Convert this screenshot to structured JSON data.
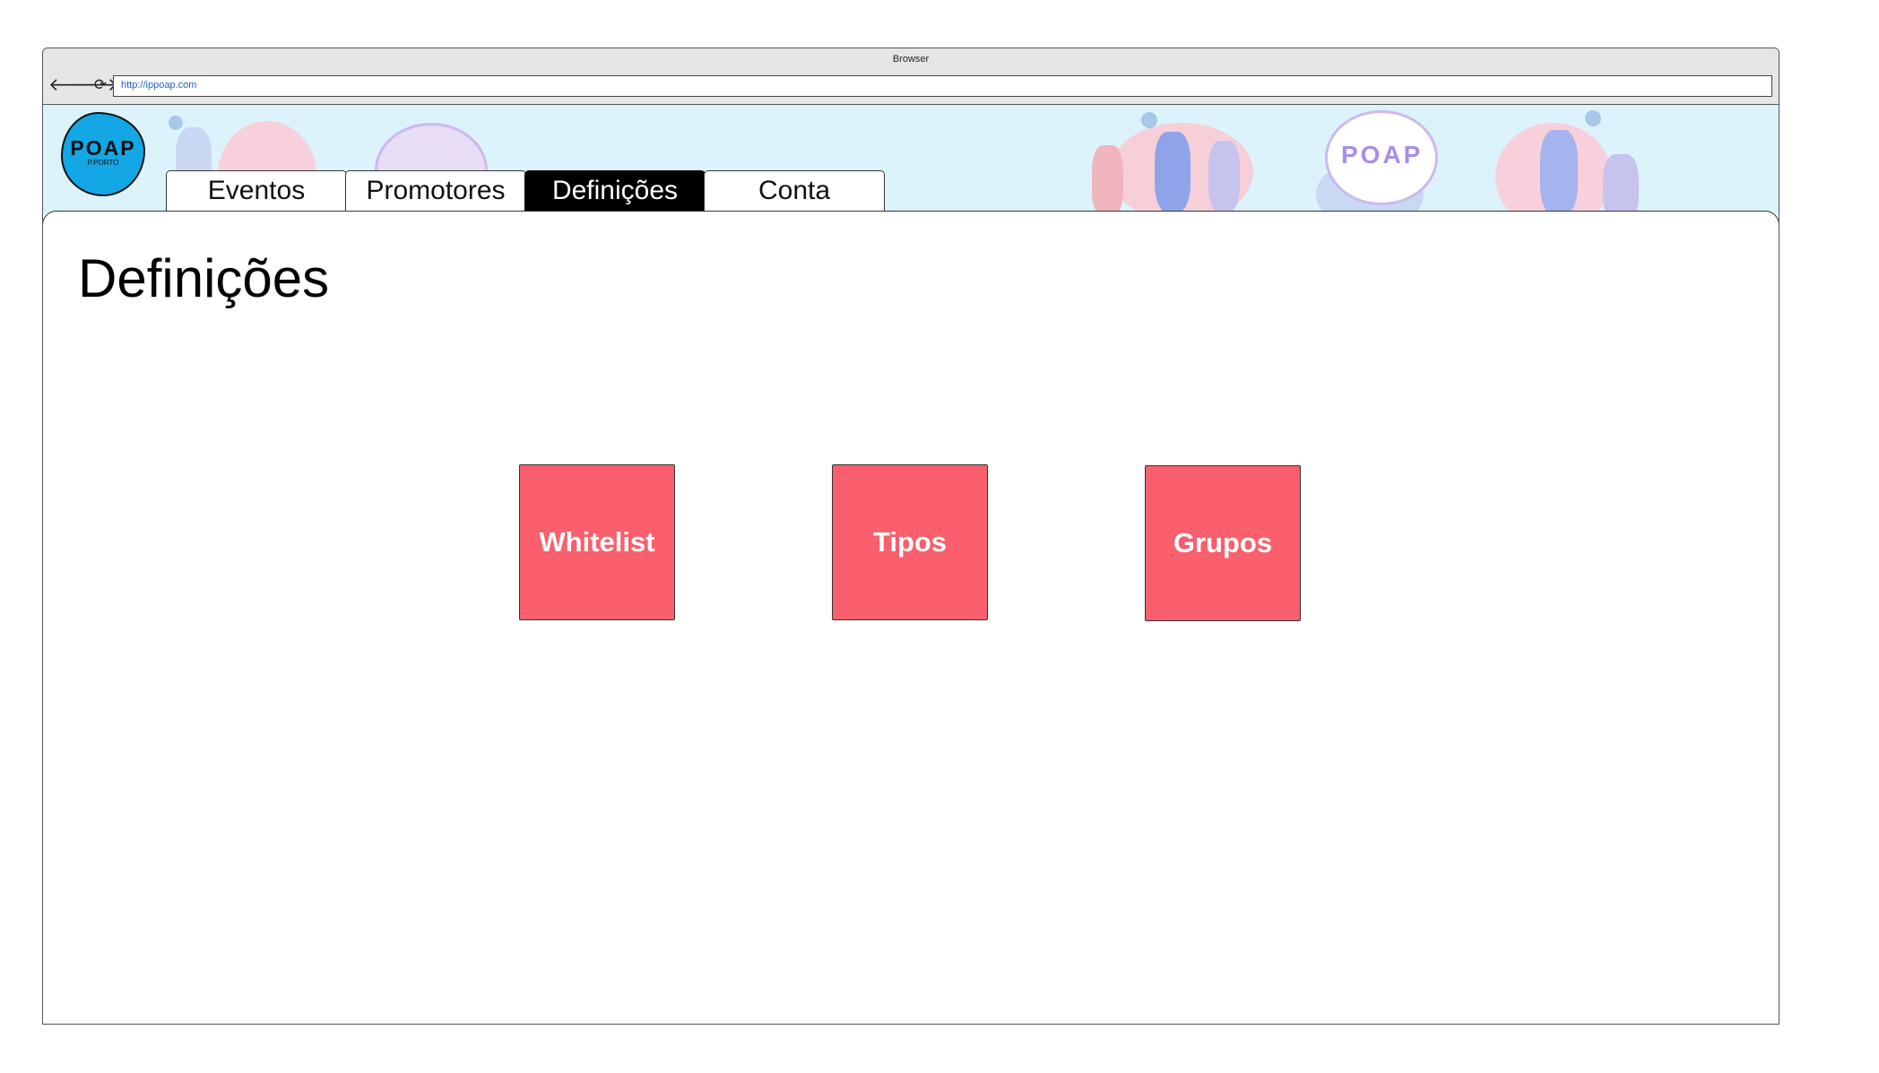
{
  "browser": {
    "window_title": "Browser",
    "url": "http://ippoap.com",
    "back_icon": "arrow-left-icon",
    "forward_icon": "arrow-right-icon",
    "reload_icon": "reload-icon"
  },
  "header": {
    "logo_text": "POAP",
    "logo_subtext": "P.PORTO",
    "banner_watermark": "POAP"
  },
  "tabs": [
    {
      "label": "Eventos",
      "active": false
    },
    {
      "label": "Promotores",
      "active": false
    },
    {
      "label": "Definições",
      "active": true
    },
    {
      "label": "Conta",
      "active": false
    }
  ],
  "main": {
    "title": "Definições",
    "tiles": [
      {
        "label": "Whitelist"
      },
      {
        "label": "Tipos"
      },
      {
        "label": "Grupos"
      }
    ]
  },
  "colors": {
    "tile_bg": "#f95f6c",
    "banner_bg": "#ddf3fc",
    "logo_bg": "#13a7e6",
    "active_tab_bg": "#000000"
  }
}
